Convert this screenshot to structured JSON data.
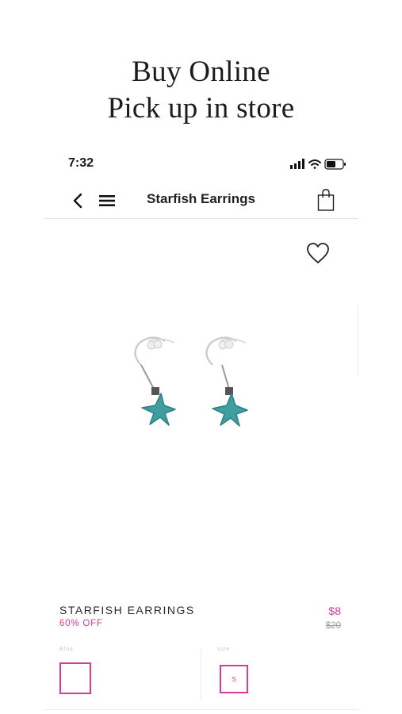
{
  "promo": {
    "line1": "Buy Online",
    "line2": "Pick up in store"
  },
  "status_bar": {
    "time": "7:32",
    "icons": [
      "signal-icon",
      "wifi-icon",
      "battery-icon"
    ]
  },
  "nav": {
    "title": "Starfish Earrings",
    "back_icon": "chevron-left-icon",
    "menu_icon": "hamburger-menu-icon",
    "bag_icon": "shopping-bag-icon"
  },
  "product": {
    "favorite_icon": "heart-icon",
    "image": "starfish-earrings-image",
    "name": "STARFISH EARRINGS",
    "discount": "60% OFF",
    "price": "$8",
    "original_price": "$20"
  },
  "options": {
    "color_label": "Blue",
    "size_label": "size",
    "size_value": "S"
  },
  "colors": {
    "accent": "#d43c95",
    "turquoise": "#3f9ea0",
    "text": "#1a1a1a"
  }
}
